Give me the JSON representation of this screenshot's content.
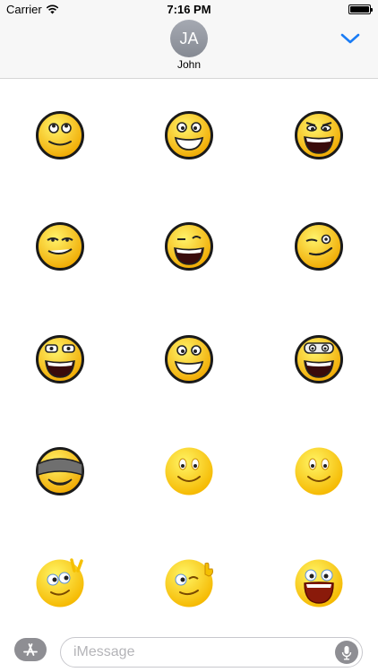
{
  "status_bar": {
    "carrier": "Carrier",
    "time": "7:16 PM",
    "wifi_icon": "wifi-icon",
    "battery_icon": "battery-icon",
    "battery_level": 1.0
  },
  "header": {
    "avatar_initials": "JA",
    "contact_name": "John",
    "collapse_icon": "chevron-down-icon",
    "accent_color": "#1a7cf5"
  },
  "stickers": [
    {
      "name": "smiley-looking-up"
    },
    {
      "name": "smiley-wide-grin"
    },
    {
      "name": "smiley-laughing-raised-brows"
    },
    {
      "name": "smiley-smirk"
    },
    {
      "name": "smiley-wink-laugh"
    },
    {
      "name": "smiley-wink-smirk"
    },
    {
      "name": "smiley-glasses-laugh"
    },
    {
      "name": "smiley-big-eyes-grin"
    },
    {
      "name": "smiley-goggles-laugh"
    },
    {
      "name": "smiley-headband-grin"
    },
    {
      "name": "smiley-simple-smile"
    },
    {
      "name": "smiley-simple-smile-2"
    },
    {
      "name": "smiley-peace-sign"
    },
    {
      "name": "smiley-thumbs-up-wink"
    },
    {
      "name": "smiley-open-mouth-shout"
    }
  ],
  "input_bar": {
    "appstore_icon": "app-store-icon",
    "placeholder": "iMessage",
    "mic_icon": "microphone-icon"
  }
}
